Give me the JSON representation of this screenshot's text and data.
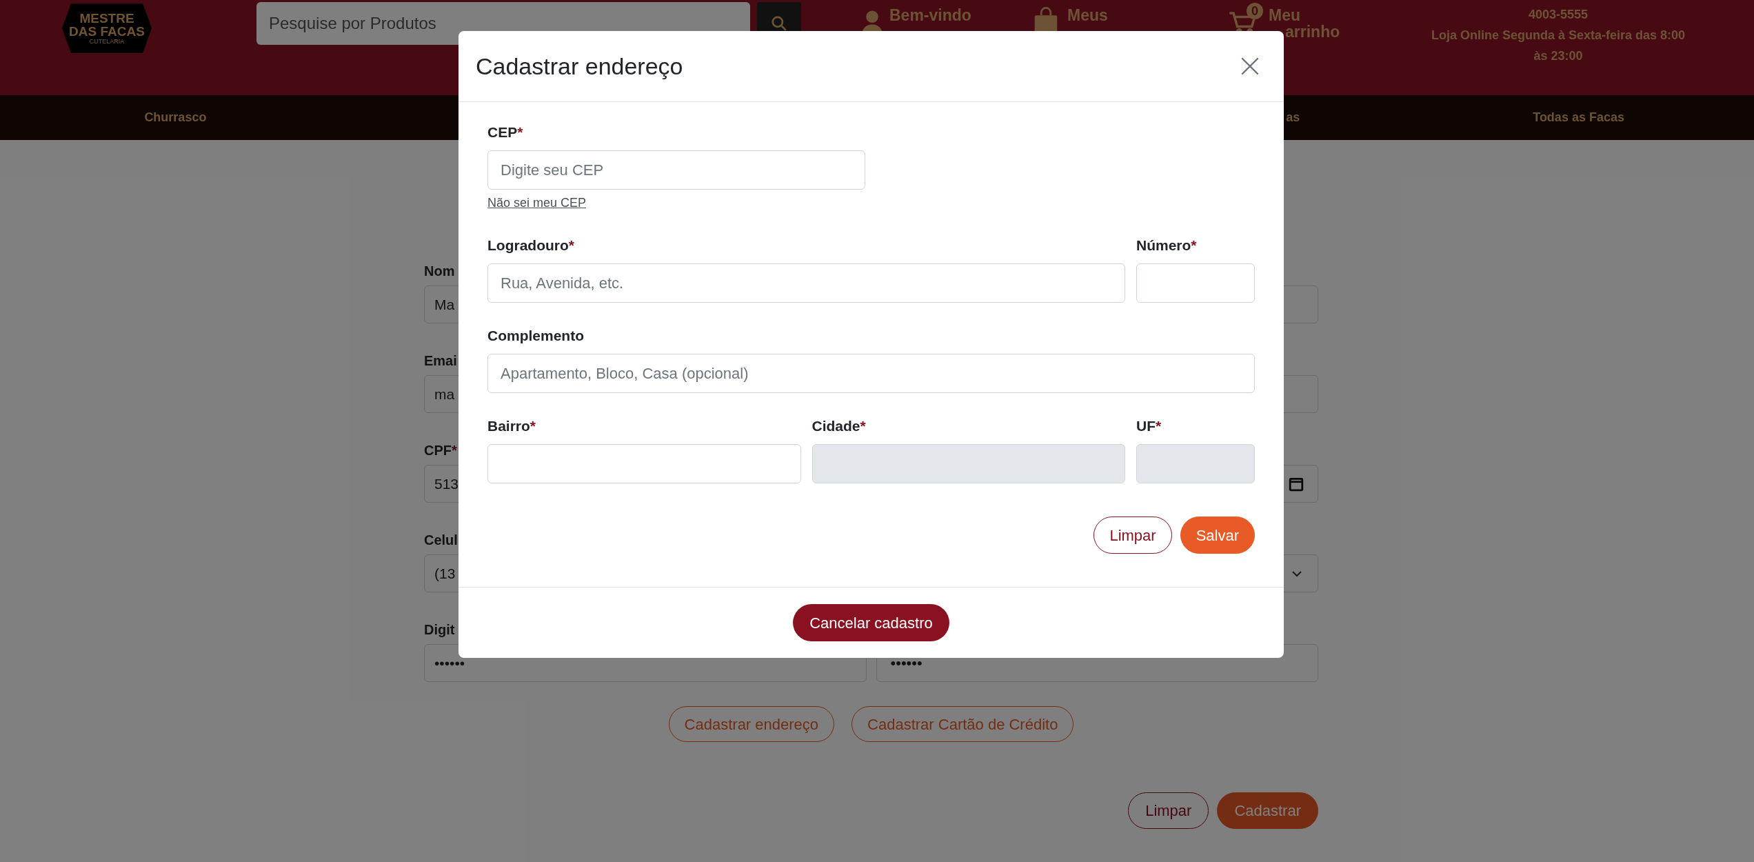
{
  "header": {
    "logo": {
      "line_1": "MESTRE",
      "line_2": "DAS FACAS",
      "tagline": "CUTELARIA"
    },
    "search": {
      "placeholder": "Pesquise por Produtos"
    },
    "account": {
      "line_1": "Bem-vindo"
    },
    "orders": {
      "label": "Meus"
    },
    "cart": {
      "count": "0",
      "line_1": "Meu",
      "line_2": "arrinho"
    },
    "contact": {
      "phone": "4003-5555",
      "hours": "Loja Online Segunda à Sexta-feira das 8:00 às 23:00"
    }
  },
  "nav": [
    {
      "label": "Churrasco"
    },
    {
      "label": "as"
    },
    {
      "label": "Todas as Facas"
    }
  ],
  "form": {
    "rows": [
      {
        "label": "Nom",
        "value": "Ma",
        "right_field": {
          "kind": "text"
        }
      },
      {
        "label": "Emai",
        "value": "ma",
        "right_field": {
          "kind": "text"
        }
      },
      {
        "label": "CPF",
        "required_mark": "*",
        "value": "513",
        "right_field": {
          "kind": "date"
        }
      },
      {
        "label": "Celul",
        "value": "(13",
        "right_field": {
          "kind": "select"
        }
      },
      {
        "label": "Digit",
        "value": "••••••",
        "right_field": {
          "kind": "password",
          "value": "••••••"
        }
      }
    ],
    "links": [
      "Cadastrar endereço",
      "Cadastrar Cartão de Crédito"
    ],
    "actions": [
      {
        "label": "Limpar",
        "kind": "outline"
      },
      {
        "label": "Cadastrar",
        "kind": "primary"
      }
    ]
  },
  "modal": {
    "title": "Cadastrar endereço",
    "fields": [
      {
        "label": "CEP",
        "required_mark": "*",
        "placeholder": "Digite seu CEP",
        "disabled": false,
        "link": "Não sei meu CEP"
      },
      {
        "label": "Logradouro",
        "required_mark": "*",
        "placeholder": "Rua, Avenida, etc.",
        "disabled": false
      },
      {
        "label": "Número",
        "required_mark": "*",
        "disabled": false
      },
      {
        "label": "Complemento",
        "placeholder": "Apartamento, Bloco, Casa (opcional)",
        "disabled": false
      },
      {
        "label": "Bairro",
        "required_mark": "*",
        "disabled": false
      },
      {
        "label": "Cidade",
        "required_mark": "*",
        "disabled": true
      },
      {
        "label": "UF",
        "required_mark": "*",
        "disabled": true
      }
    ],
    "actions": [
      {
        "label": "Limpar",
        "kind": "outline"
      },
      {
        "label": "Salvar",
        "kind": "primary"
      }
    ],
    "footer_button": "Cancelar cadastro"
  }
}
